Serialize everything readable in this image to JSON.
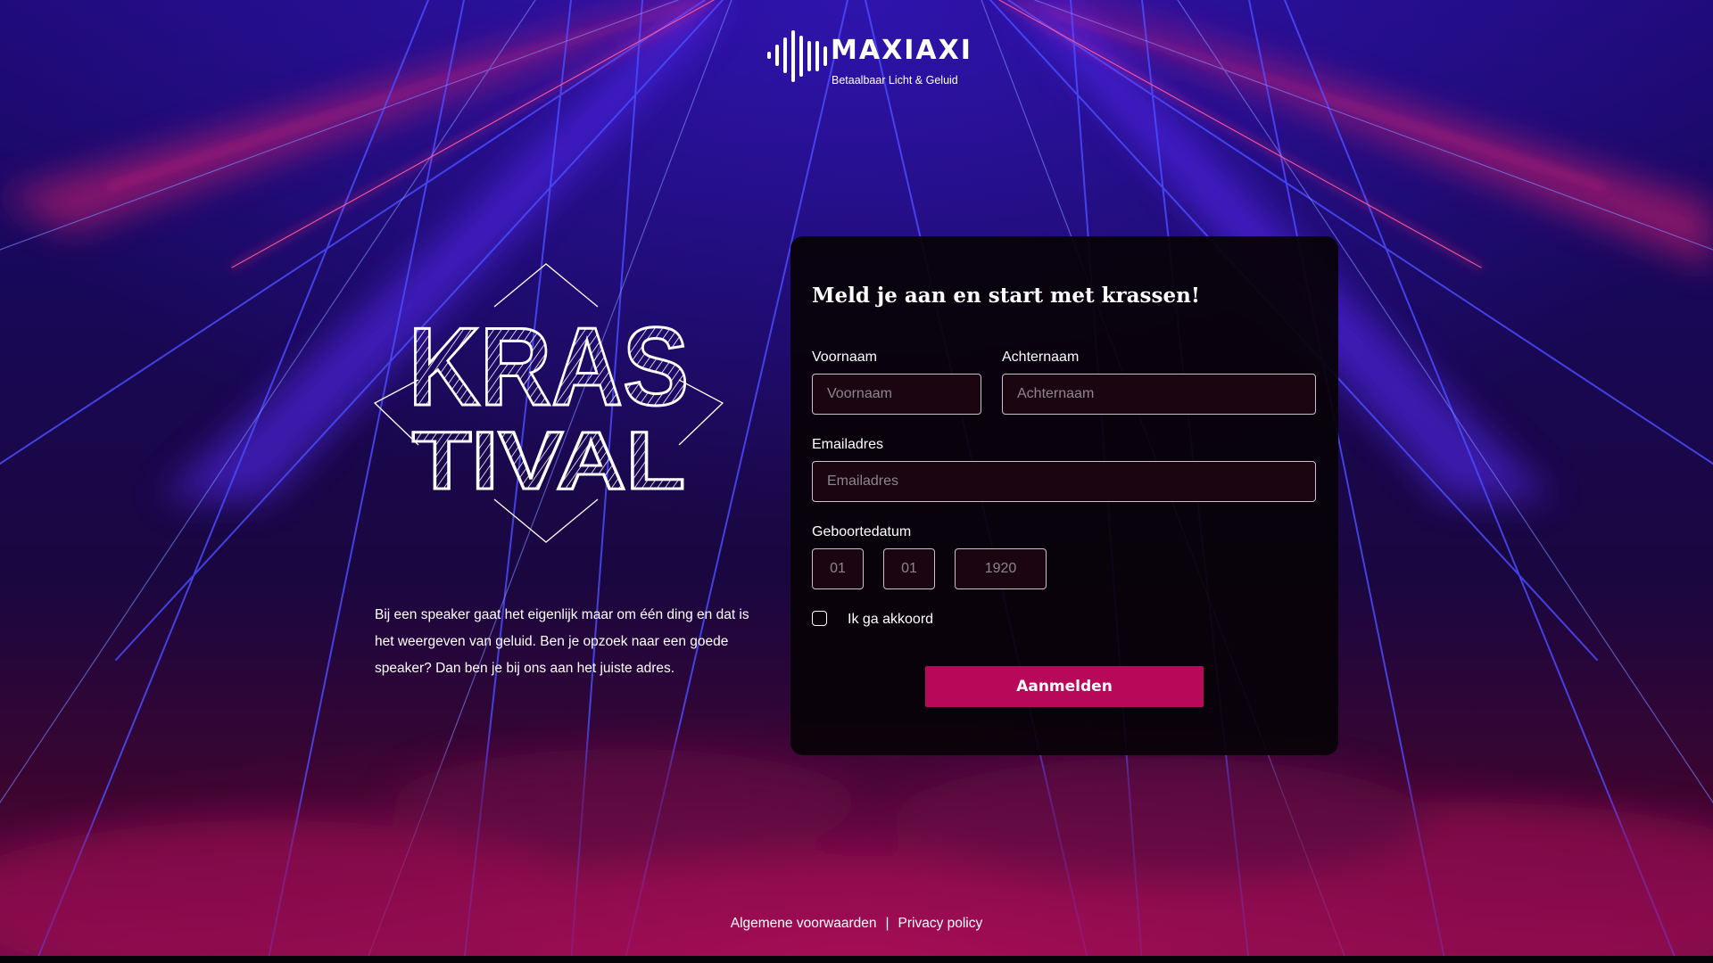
{
  "brand": {
    "name": "MAXIAXI",
    "tagline": "Betaalbaar Licht & Geluid"
  },
  "festival": {
    "logo_lines": [
      "KRAS",
      "TIVAL"
    ],
    "intro": "Bij een speaker gaat het eigenlijk maar om één ding en dat is het weergeven van geluid. Ben je opzoek naar een goede speaker? Dan ben je bij ons aan het juiste adres."
  },
  "form": {
    "title": "Meld je aan en start met krassen!",
    "first_name": {
      "label": "Voornaam",
      "placeholder": "Voornaam",
      "value": ""
    },
    "last_name": {
      "label": "Achternaam",
      "placeholder": "Achternaam",
      "value": ""
    },
    "email": {
      "label": "Emailadres",
      "placeholder": "Emailadres",
      "value": ""
    },
    "birthdate": {
      "label": "Geboortedatum",
      "day_placeholder": "01",
      "month_placeholder": "01",
      "year_placeholder": "1920"
    },
    "agree": {
      "label": "Ik ga akkoord",
      "checked": false
    },
    "submit_label": "Aanmelden"
  },
  "footer": {
    "terms_label": "Algemene voorwaarden",
    "separator": "|",
    "privacy_label": "Privacy policy"
  },
  "colors": {
    "accent": "#b8085a",
    "input_bg": "#1a0511",
    "card_bg": "#080208"
  }
}
